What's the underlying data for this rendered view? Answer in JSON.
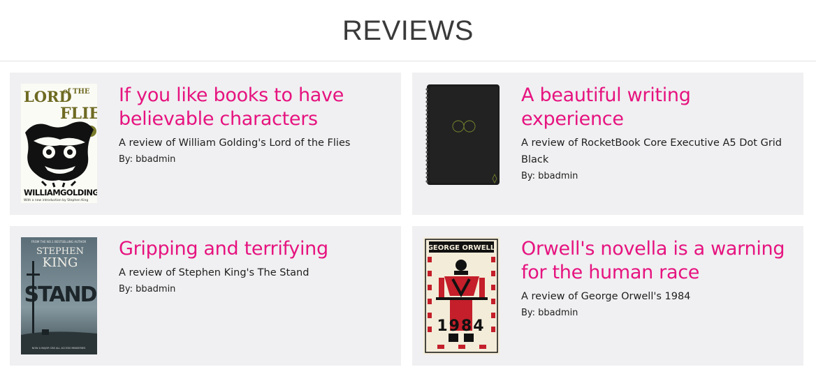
{
  "header": {
    "title": "REVIEWS"
  },
  "reviews": [
    {
      "title": "If you like books to have believable characters",
      "subtitle": "A review of William Golding's Lord of the Flies",
      "author": "By: bbadmin",
      "cover": {
        "top_text": "LORD of THE FLIES",
        "bottom_text": "WILLIAMGOLDING",
        "intro_text": "With a new introduction by Stephen King"
      }
    },
    {
      "title": "A beautiful writing experience",
      "subtitle": "A review of RocketBook Core Executive A5 Dot Grid Black",
      "author": "By: bbadmin",
      "cover": {
        "top_text": "",
        "bottom_text": "",
        "intro_text": ""
      }
    },
    {
      "title": "Gripping and terrifying",
      "subtitle": "A review of Stephen King's The Stand",
      "author": "By: bbadmin",
      "cover": {
        "top_text": "STEPHEN KING",
        "bottom_text": "STAND",
        "intro_text": "FROM THE NO.1 BESTSELLING AUTHOR"
      }
    },
    {
      "title": "Orwell's novella is a warning for the human race",
      "subtitle": "A review of George Orwell's 1984",
      "author": "By: bbadmin",
      "cover": {
        "top_text": "GEORGE ORWELL",
        "bottom_text": "1984",
        "intro_text": ""
      }
    }
  ]
}
